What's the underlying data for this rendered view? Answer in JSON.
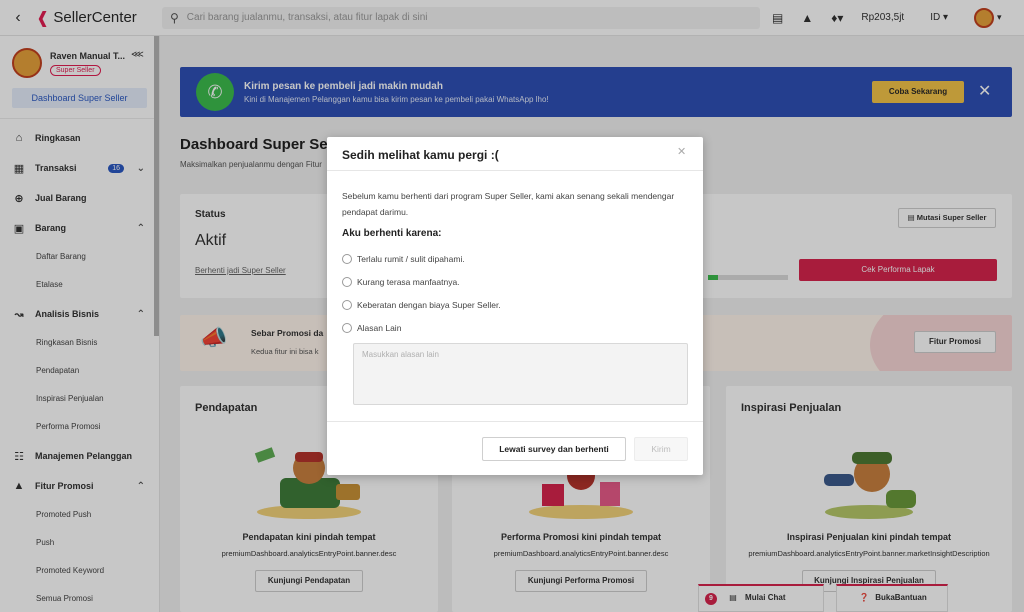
{
  "topbar": {
    "logo_text": "SellerCenter",
    "search_placeholder": "Cari barang jualanmu, transaksi, atau fitur lapak di sini",
    "balance": "Rp203,5jt",
    "language": "ID"
  },
  "sidebar": {
    "profile_name": "Raven Manual T...",
    "profile_badge": "Super Seller",
    "dashboard_button": "Dashboard Super Seller",
    "items": [
      {
        "label": "Ringkasan"
      },
      {
        "label": "Transaksi",
        "count": "16"
      },
      {
        "label": "Jual Barang"
      },
      {
        "label": "Barang"
      },
      {
        "label": "Analisis Bisnis"
      },
      {
        "label": "Manajemen Pelanggan"
      },
      {
        "label": "Fitur Promosi"
      }
    ],
    "barang_sub": [
      "Daftar Barang",
      "Etalase"
    ],
    "analisis_sub": [
      "Ringkasan Bisnis",
      "Pendapatan",
      "Inspirasi Penjualan",
      "Performa Promosi"
    ],
    "promosi_sub": [
      "Promoted Push",
      "Push",
      "Promoted Keyword",
      "Semua Promosi"
    ]
  },
  "banner": {
    "title": "Kirim pesan ke pembeli jadi makin mudah",
    "subtitle": "Kini di Manajemen Pelanggan kamu bisa kirim pesan ke pembeli pakai WhatsApp lho!",
    "button": "Coba Sekarang"
  },
  "main": {
    "title": "Dashboard Super Seller",
    "subtitle": "Maksimalkan penjualanmu dengan Fitur",
    "status_label": "Status",
    "status_value": "Aktif",
    "status_link": "Berhenti jadi Super Seller",
    "mutasi_button": "Mutasi Super Seller",
    "cek_button": "Cek Performa Lapak",
    "progress_fraction": 0.12,
    "promo_title": "Sebar Promosi da",
    "promo_sub": "Kedua fitur ini bisa k",
    "promo_button": "Fitur Promosi"
  },
  "cards": [
    {
      "title": "Pendapatan",
      "heading": "Pendapatan kini pindah tempat",
      "code": "premiumDashboard.analyticsEntryPoint.banner.desc",
      "button": "Kunjungi Pendapatan"
    },
    {
      "title": "",
      "heading": "Performa Promosi kini pindah tempat",
      "code": "premiumDashboard.analyticsEntryPoint.banner.desc",
      "button": "Kunjungi Performa Promosi"
    },
    {
      "title": "Inspirasi Penjualan",
      "heading": "Inspirasi Penjualan kini pindah tempat",
      "code": "premiumDashboard.analyticsEntryPoint.banner.marketInsightDescription",
      "button": "Kunjungi Inspirasi Penjualan"
    }
  ],
  "floating": {
    "chat": "Mulai Chat",
    "chat_count": "9",
    "help": "BukaBantuan"
  },
  "modal": {
    "title": "Sedih melihat kamu pergi :(",
    "description": "Sebelum kamu berhenti dari program Super Seller, kami akan senang sekali mendengar pendapat darimu.",
    "reason_title": "Aku berhenti karena:",
    "options": [
      "Terlalu rumit / sulit dipahami.",
      "Kurang terasa manfaatnya.",
      "Keberatan dengan biaya Super Seller.",
      "Alasan Lain"
    ],
    "textarea_placeholder": "Masukkan alasan lain",
    "skip_button": "Lewati survey dan berhenti",
    "send_button": "Kirim"
  },
  "colors": {
    "brand": "#e31e52",
    "banner_blue": "#2f50b6",
    "primary_red": "#d8244e",
    "accent_yellow": "#f4c449"
  }
}
